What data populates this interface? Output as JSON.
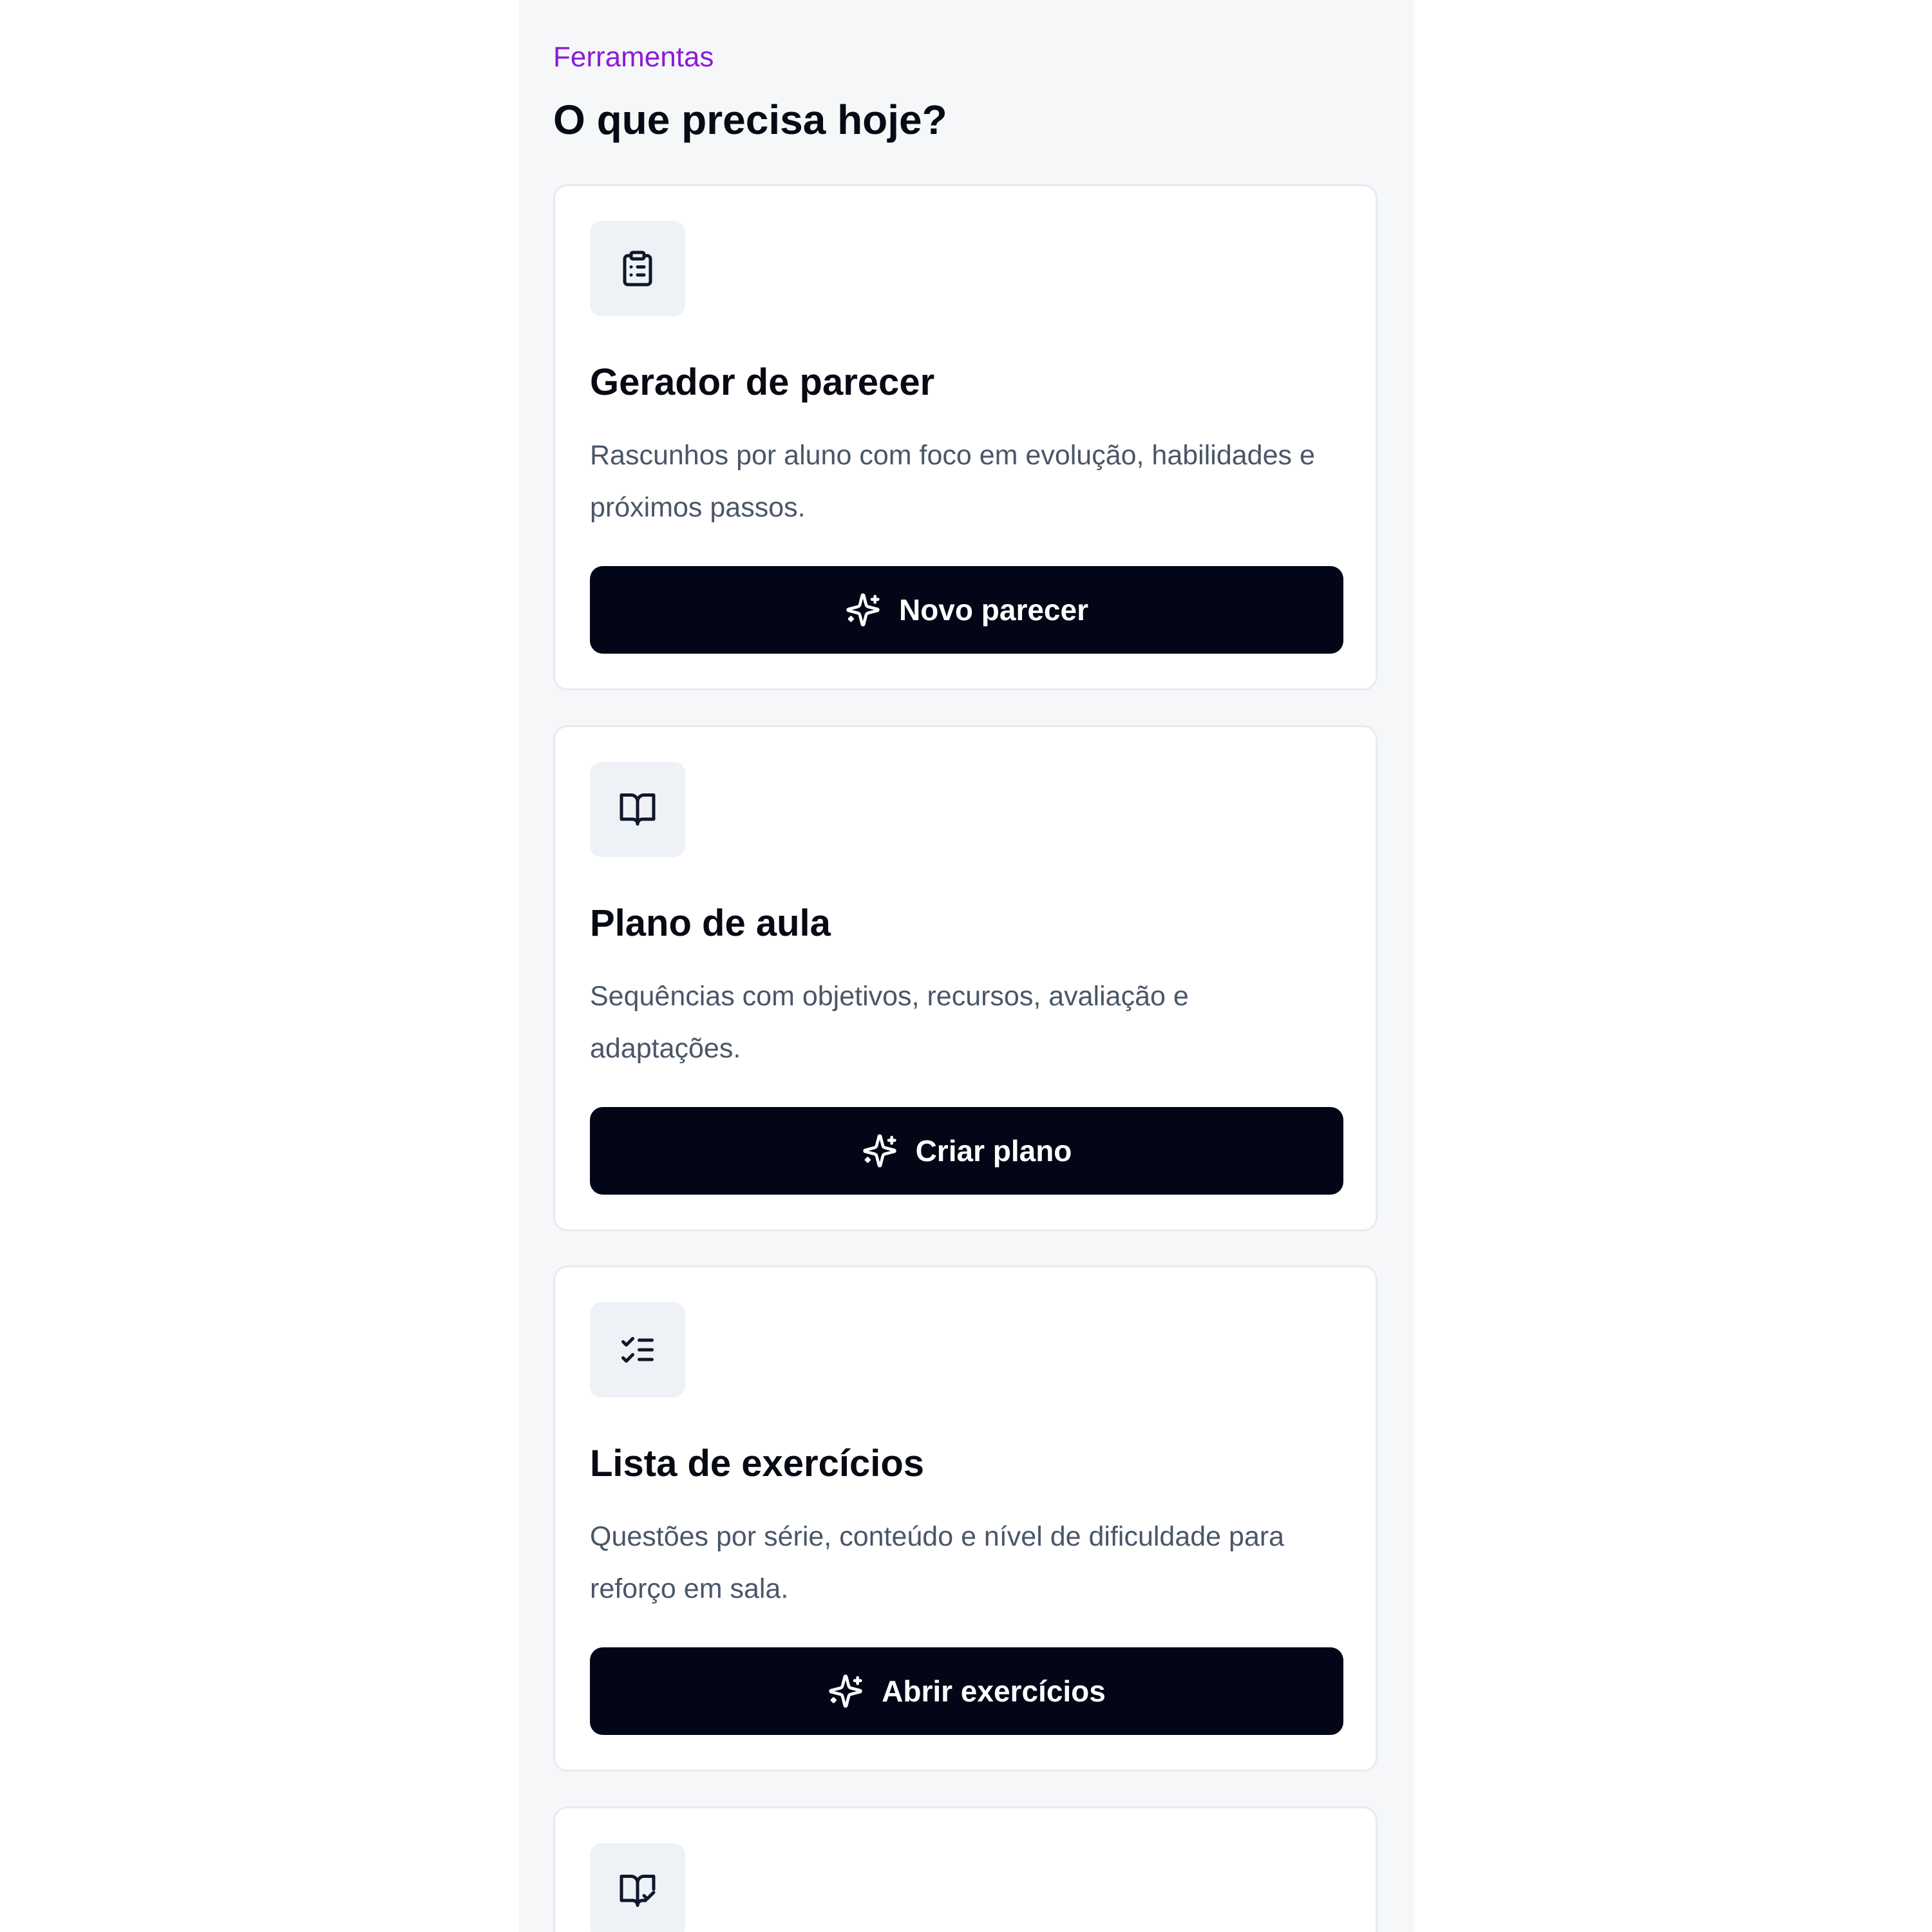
{
  "header": {
    "eyebrow": "Ferramentas",
    "title": "O que precisa hoje?"
  },
  "cards": [
    {
      "icon": "clipboard-list-icon",
      "title": "Gerador de parecer",
      "description": "Rascunhos por aluno com foco em evolução, habilidades e próximos passos.",
      "button_label": "Novo parecer",
      "button_icon": "sparkles-icon"
    },
    {
      "icon": "book-open-icon",
      "title": "Plano de aula",
      "description": "Sequências com objetivos, recursos, avaliação e adaptações.",
      "button_label": "Criar plano",
      "button_icon": "sparkles-icon"
    },
    {
      "icon": "list-checks-icon",
      "title": "Lista de exercícios",
      "description": "Questões por série, conteúdo e nível de dificuldade para reforço em sala.",
      "button_label": "Abrir exercícios",
      "button_icon": "sparkles-icon"
    },
    {
      "icon": "book-check-icon"
    }
  ],
  "colors": {
    "accent": "#8b1bd6",
    "page_background": "#f6f7f9",
    "card_background": "#ffffff",
    "button_background": "#020617",
    "heading_text": "#070a14",
    "body_text": "#4a5668"
  }
}
